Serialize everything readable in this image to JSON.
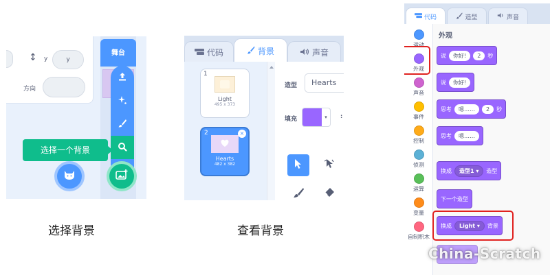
{
  "panel1": {
    "y_label": "y",
    "y_value": "y",
    "direction_label": "方向",
    "stage_header": "舞台",
    "tooltip": "选择一个背景",
    "menu_icons": [
      "upload-icon",
      "sparkle-icon",
      "paint-brush-icon",
      "search-icon"
    ],
    "sprite_button_icon": "cat-icon",
    "backdrop_button_icon": "image-add-icon"
  },
  "panel2": {
    "tabs": [
      {
        "label": "代码",
        "icon": "code-icon"
      },
      {
        "label": "背景",
        "icon": "brush-icon"
      },
      {
        "label": "声音",
        "icon": "speaker-icon"
      }
    ],
    "backdrops": [
      {
        "num": "1",
        "name": "Light",
        "size": "495 x 373"
      },
      {
        "num": "2",
        "name": "Hearts",
        "size": "482 x 382"
      }
    ],
    "costume_label": "造型",
    "costume_name": "Hearts",
    "fill_label": "填充",
    "fill_color": "#9966ff",
    "tools": [
      "select-arrow-icon",
      "reshape-icon",
      "brush-tool-icon",
      "eraser-icon"
    ]
  },
  "panel3": {
    "tabs": [
      {
        "label": "代码",
        "icon": "code-icon"
      },
      {
        "label": "造型",
        "icon": "brush-icon"
      },
      {
        "label": "声音",
        "icon": "speaker-icon"
      }
    ],
    "categories": [
      {
        "label": "运动",
        "color": "#4c97ff"
      },
      {
        "label": "外观",
        "color": "#9966ff"
      },
      {
        "label": "声音",
        "color": "#cf63cf"
      },
      {
        "label": "事件",
        "color": "#ffbf00"
      },
      {
        "label": "控制",
        "color": "#ffab19"
      },
      {
        "label": "侦测",
        "color": "#5cb1d6"
      },
      {
        "label": "运算",
        "color": "#59c059"
      },
      {
        "label": "变量",
        "color": "#ff8c1a"
      },
      {
        "label": "自制积木",
        "color": "#ff6680"
      }
    ],
    "section_title": "外观",
    "blocks": {
      "say_secs": {
        "pre": "说",
        "input": "你好!",
        "num": "2",
        "post": "秒"
      },
      "say": {
        "pre": "说",
        "input": "你好!"
      },
      "think_secs": {
        "pre": "思考",
        "input": "嗯……",
        "num": "2",
        "post": "秒"
      },
      "think": {
        "pre": "思考",
        "input": "嗯……"
      },
      "switch_costume": {
        "pre": "换成",
        "dropdown": "造型1 ▾",
        "post": "造型"
      },
      "next_costume": {
        "label": "下一个造型"
      },
      "switch_backdrop": {
        "pre": "换成",
        "dropdown": "Light ▾",
        "post": "背景"
      }
    }
  },
  "captions": {
    "choose": "选择背景",
    "view": "查看背景"
  },
  "watermark": "China-Scratch"
}
